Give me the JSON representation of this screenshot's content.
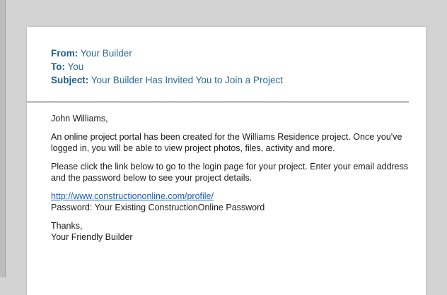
{
  "email": {
    "from_key": "From:",
    "from_value": "Your Builder",
    "to_key": "To:",
    "to_value": "You",
    "subject_key": "Subject:",
    "subject_value": "Your Builder Has Invited You to Join a Project"
  },
  "body": {
    "greeting": "John Williams,",
    "para1": "An online project portal has been created for the Williams Residence project. Once you've logged in, you will be able to view project photos, files, activity and more.",
    "para2": "Please click the link below to go to the login page for your project. Enter your email address and the password below to see your project details.",
    "link": "http://www.constructiononline.com/profile/",
    "password_line": "Password: Your Existing ConstructionOnline Password",
    "thanks": "Thanks,",
    "signature": "Your Friendly Builder"
  }
}
